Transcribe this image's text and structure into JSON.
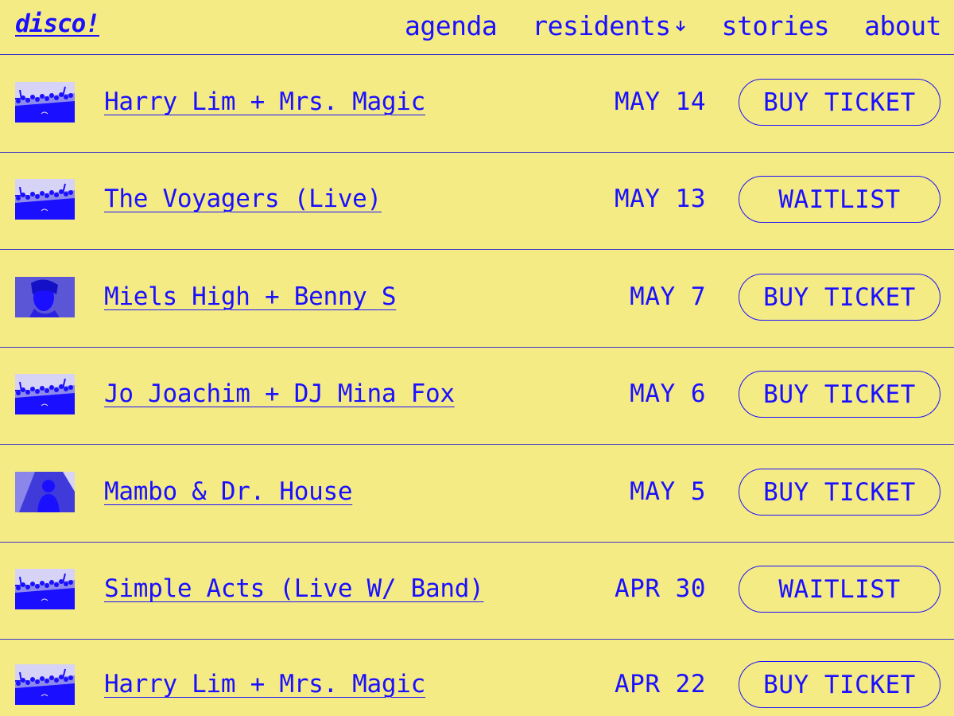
{
  "header": {
    "logo": "disco!",
    "nav": [
      {
        "label": "agenda",
        "name": "nav-agenda"
      },
      {
        "label": "residents",
        "name": "nav-residents",
        "has_caret": true
      },
      {
        "label": "stories",
        "name": "nav-stories"
      },
      {
        "label": "about",
        "name": "nav-about"
      }
    ]
  },
  "colors": {
    "background": "#f5eb84",
    "accent": "#1a10ff",
    "divider": "#3b35c7"
  },
  "events": [
    {
      "title": "Harry Lim + Mrs. Magic",
      "date": "MAY 14",
      "action": "BUY TICKET",
      "thumb": "crowd"
    },
    {
      "title": "The Voyagers (Live)",
      "date": "MAY 13",
      "action": "WAITLIST",
      "thumb": "crowd"
    },
    {
      "title": "Miels High + Benny S",
      "date": "MAY 7",
      "action": "BUY TICKET",
      "thumb": "portrait"
    },
    {
      "title": "Jo Joachim + DJ Mina Fox",
      "date": "MAY 6",
      "action": "BUY TICKET",
      "thumb": "crowd"
    },
    {
      "title": "Mambo & Dr. House",
      "date": "MAY 5",
      "action": "BUY TICKET",
      "thumb": "person"
    },
    {
      "title": "Simple Acts (Live W/ Band)",
      "date": "APR 30",
      "action": "WAITLIST",
      "thumb": "crowd"
    },
    {
      "title": "Harry Lim + Mrs. Magic",
      "date": "APR 22",
      "action": "BUY TICKET",
      "thumb": "crowd"
    }
  ]
}
